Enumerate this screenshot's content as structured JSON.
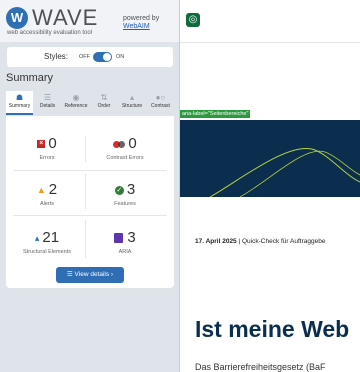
{
  "wave": {
    "logo_text": "WAVE",
    "tagline": "web accessibility evaluation tool",
    "powered_by": "powered by",
    "webaim": "WebAIM"
  },
  "styles": {
    "label": "Styles:",
    "off": "OFF",
    "on": "ON",
    "enabled": true
  },
  "summary_heading": "Summary",
  "tabs": [
    {
      "label": "Summary",
      "icon": "home-icon",
      "active": true
    },
    {
      "label": "Details",
      "icon": "list-icon",
      "active": false
    },
    {
      "label": "Reference",
      "icon": "info-icon",
      "active": false
    },
    {
      "label": "Order",
      "icon": "order-icon",
      "active": false
    },
    {
      "label": "Structure",
      "icon": "structure-icon",
      "active": false
    },
    {
      "label": "Contrast",
      "icon": "contrast-icon",
      "active": false
    }
  ],
  "stats": {
    "errors": {
      "count": "0",
      "label": "Errors",
      "color": "#c62828"
    },
    "contrast": {
      "count": "0",
      "label": "Contrast Errors",
      "color": "#d32f2f"
    },
    "alerts": {
      "count": "2",
      "label": "Alerts",
      "color": "#f39c12"
    },
    "features": {
      "count": "3",
      "label": "Features",
      "color": "#2e7d32"
    },
    "structural": {
      "count": "21",
      "label": "Structural Elements",
      "color": "#2e6fb6"
    },
    "aria": {
      "count": "3",
      "label": "ARIA",
      "color": "#5e35b1"
    }
  },
  "view_details": "View details ›",
  "page": {
    "aria_tag": "aria-label=\"Seitenbereiche\"",
    "date": "17. April 2025",
    "date_rest": " | Quick-Check für Auftraggebe",
    "heading": "Ist meine Web",
    "body": "Das Barrierefreiheitsgesetz (BaF"
  },
  "colors": {
    "accent": "#2e6fb6",
    "hero": "#0b2e4f",
    "aria_green": "#2c9a3c"
  }
}
